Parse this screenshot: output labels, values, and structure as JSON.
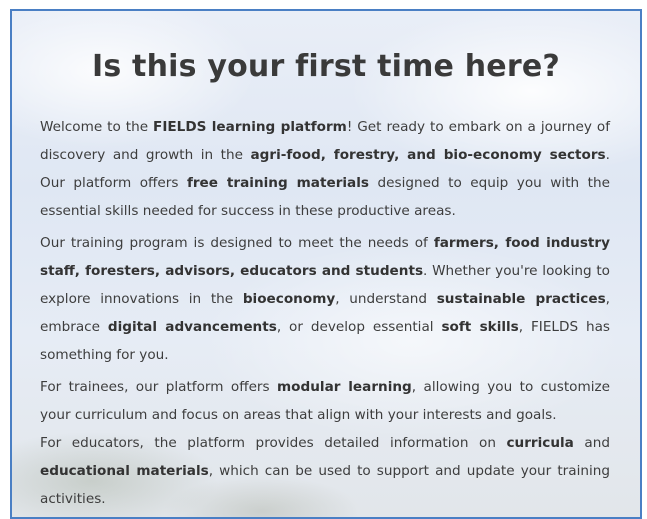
{
  "title": "Is this your first time here?",
  "paragraphs": [
    {
      "parts": [
        {
          "t": "Welcome to the ",
          "b": false
        },
        {
          "t": "FIELDS learning platform",
          "b": true
        },
        {
          "t": "! Get ready to embark on a journey of discovery and growth in the ",
          "b": false
        },
        {
          "t": "agri-food, forestry, and bio-economy sectors",
          "b": true
        },
        {
          "t": ". Our platform offers ",
          "b": false
        },
        {
          "t": "free training materials",
          "b": true
        },
        {
          "t": " designed to equip you with the essential skills needed for success in these productive areas.",
          "b": false
        }
      ]
    },
    {
      "parts": [
        {
          "t": "Our training program is designed to meet the needs of ",
          "b": false
        },
        {
          "t": "farmers, food industry staff, foresters, advisors, educators and students",
          "b": true
        },
        {
          "t": ". Whether you're looking to explore innovations in the ",
          "b": false
        },
        {
          "t": "bioeconomy",
          "b": true
        },
        {
          "t": ", understand ",
          "b": false
        },
        {
          "t": "sustainable practices",
          "b": true
        },
        {
          "t": ", embrace ",
          "b": false
        },
        {
          "t": "digital advancements",
          "b": true
        },
        {
          "t": ", or develop essential ",
          "b": false
        },
        {
          "t": "soft skills",
          "b": true
        },
        {
          "t": ", FIELDS has something for you.",
          "b": false
        }
      ]
    },
    {
      "parts": [
        {
          "t": "For trainees, our platform offers ",
          "b": false
        },
        {
          "t": "modular learning",
          "b": true
        },
        {
          "t": ", allowing you to customize your curriculum and focus on areas that align with your interests and goals.",
          "b": false
        }
      ]
    },
    {
      "parts": [
        {
          "t": "For educators, the platform provides detailed information on ",
          "b": false
        },
        {
          "t": "curricula",
          "b": true
        },
        {
          "t": " and ",
          "b": false
        },
        {
          "t": "educational materials",
          "b": true
        },
        {
          "t": ", which can be used to support and update your training activities.",
          "b": false
        }
      ]
    }
  ]
}
